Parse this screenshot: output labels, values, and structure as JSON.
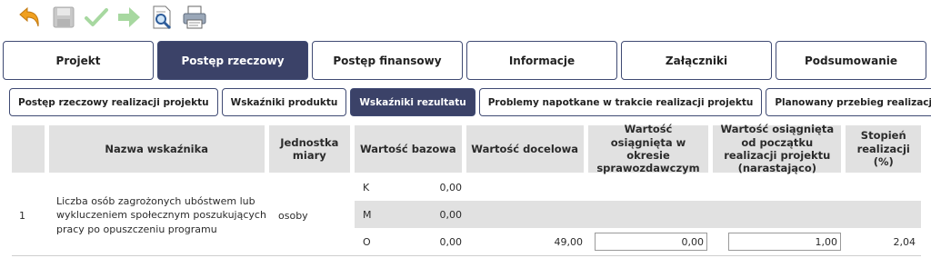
{
  "toolbar": {
    "icons": [
      "undo-icon",
      "save-icon",
      "validate-icon",
      "next-icon",
      "preview-icon",
      "print-icon"
    ]
  },
  "main_tabs": [
    {
      "label": "Projekt",
      "active": false
    },
    {
      "label": "Postęp rzeczowy",
      "active": true
    },
    {
      "label": "Postęp finansowy",
      "active": false
    },
    {
      "label": "Informacje",
      "active": false
    },
    {
      "label": "Załączniki",
      "active": false
    },
    {
      "label": "Podsumowanie",
      "active": false
    }
  ],
  "sub_tabs": [
    {
      "label": "Postęp rzeczowy realizacji projektu",
      "active": false
    },
    {
      "label": "Wskaźniki produktu",
      "active": false
    },
    {
      "label": "Wskaźniki rezultatu",
      "active": true
    },
    {
      "label": "Problemy napotkane w trakcie realizacji projektu",
      "active": false
    },
    {
      "label": "Planowany przebieg realizacji",
      "active": false
    }
  ],
  "table": {
    "headers": {
      "no": "",
      "name": "Nazwa wskaźnika",
      "unit": "Jednostka miary",
      "base": "Wartość bazowa",
      "target": "Wartość docelowa",
      "period": "Wartość osiągnięta w okresie sprawozdawczym",
      "cumulative": "Wartość osiągnięta od początku realizacji projektu (narastająco)",
      "degree": "Stopień realizacji (%)"
    },
    "row": {
      "no": "1",
      "name": "Liczba osób zagrożonych ubóstwem lub wykluczeniem społecznym poszukujących pracy po opuszczeniu programu",
      "unit": "osoby",
      "subrows": [
        {
          "letter": "K",
          "base": "0,00"
        },
        {
          "letter": "M",
          "base": "0,00"
        },
        {
          "letter": "O",
          "base": "0,00",
          "target": "49,00",
          "period": "0,00",
          "cumulative": "1,00",
          "degree": "2,04"
        }
      ]
    }
  }
}
